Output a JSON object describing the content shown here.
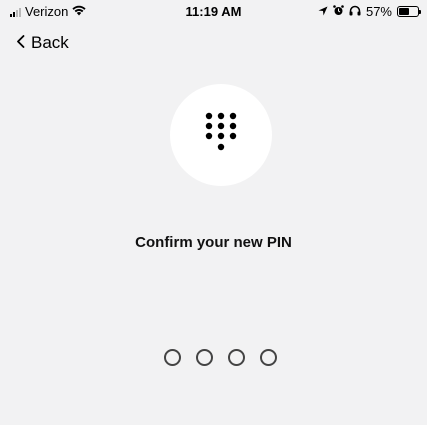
{
  "status_bar": {
    "carrier": "Verizon",
    "time": "11:19 AM",
    "battery_percent": "57%",
    "battery_level": 0.57,
    "icons": [
      "signal-icon",
      "wifi-icon",
      "location-icon",
      "alarm-icon",
      "headphones-icon",
      "battery-icon"
    ]
  },
  "nav": {
    "back_label": "Back"
  },
  "main": {
    "icon": "keypad-icon",
    "title": "Confirm your new PIN",
    "pin_length": 4,
    "pin_entered": 0
  },
  "colors": {
    "background": "#f2f2f3",
    "circle": "#ffffff",
    "dot_outline": "#444444"
  }
}
